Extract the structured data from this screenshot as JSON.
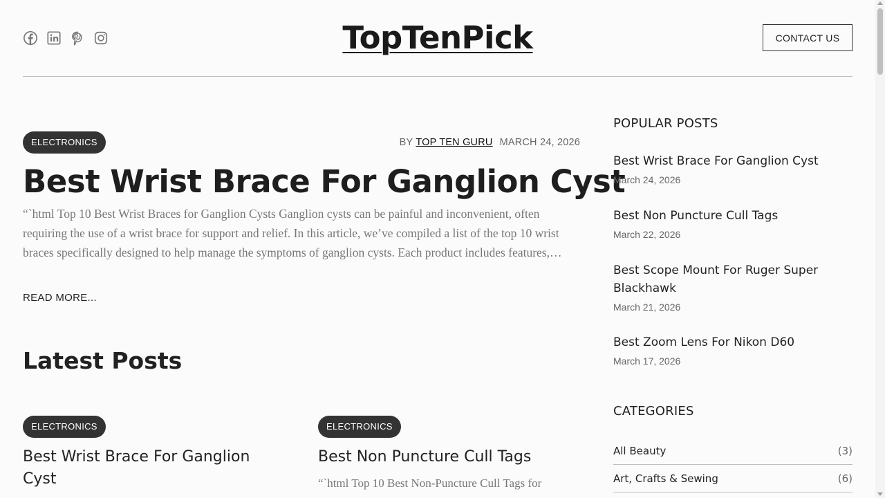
{
  "header": {
    "site_title": "TopTenPick",
    "contact_label": "CONTACT US",
    "social_icons": [
      "facebook-icon",
      "linkedin-icon",
      "pinterest-icon",
      "instagram-icon"
    ]
  },
  "featured": {
    "category": "ELECTRONICS",
    "by_label": "BY",
    "author": "TOP TEN GURU",
    "date": "MARCH 24, 2026",
    "title": "Best Wrist Brace For Ganglion Cyst",
    "excerpt": "“`html Top 10 Best Wrist Braces for Ganglion Cysts Ganglion cysts can be painful and inconvenient, often requiring the use of a wrist brace for support and relief. In this article, we’ve compiled a list of the top 10 wrist braces specifically designed to help manage the symptoms of ganglion cysts. Each product includes features,…",
    "read_more": "READ MORE..."
  },
  "latest": {
    "heading": "Latest Posts",
    "cards": [
      {
        "category": "ELECTRONICS",
        "title": "Best Wrist Brace For Ganglion Cyst",
        "excerpt": ""
      },
      {
        "category": "ELECTRONICS",
        "title": "Best Non Puncture Cull Tags",
        "excerpt": "“`html Top 10 Best Non-Puncture Cull Tags for"
      }
    ]
  },
  "sidebar": {
    "popular_title": "POPULAR POSTS",
    "popular": [
      {
        "title": "Best Wrist Brace For Ganglion Cyst",
        "date": "March 24, 2026"
      },
      {
        "title": "Best Non Puncture Cull Tags",
        "date": "March 22, 2026"
      },
      {
        "title": "Best Scope Mount For Ruger Super Blackhawk",
        "date": "March 21, 2026"
      },
      {
        "title": "Best Zoom Lens For Nikon D60",
        "date": "March 17, 2026"
      }
    ],
    "categories_title": "CATEGORIES",
    "categories": [
      {
        "name": "All Beauty",
        "count": "(3)"
      },
      {
        "name": "Art, Crafts & Sewing",
        "count": "(6)"
      }
    ]
  }
}
